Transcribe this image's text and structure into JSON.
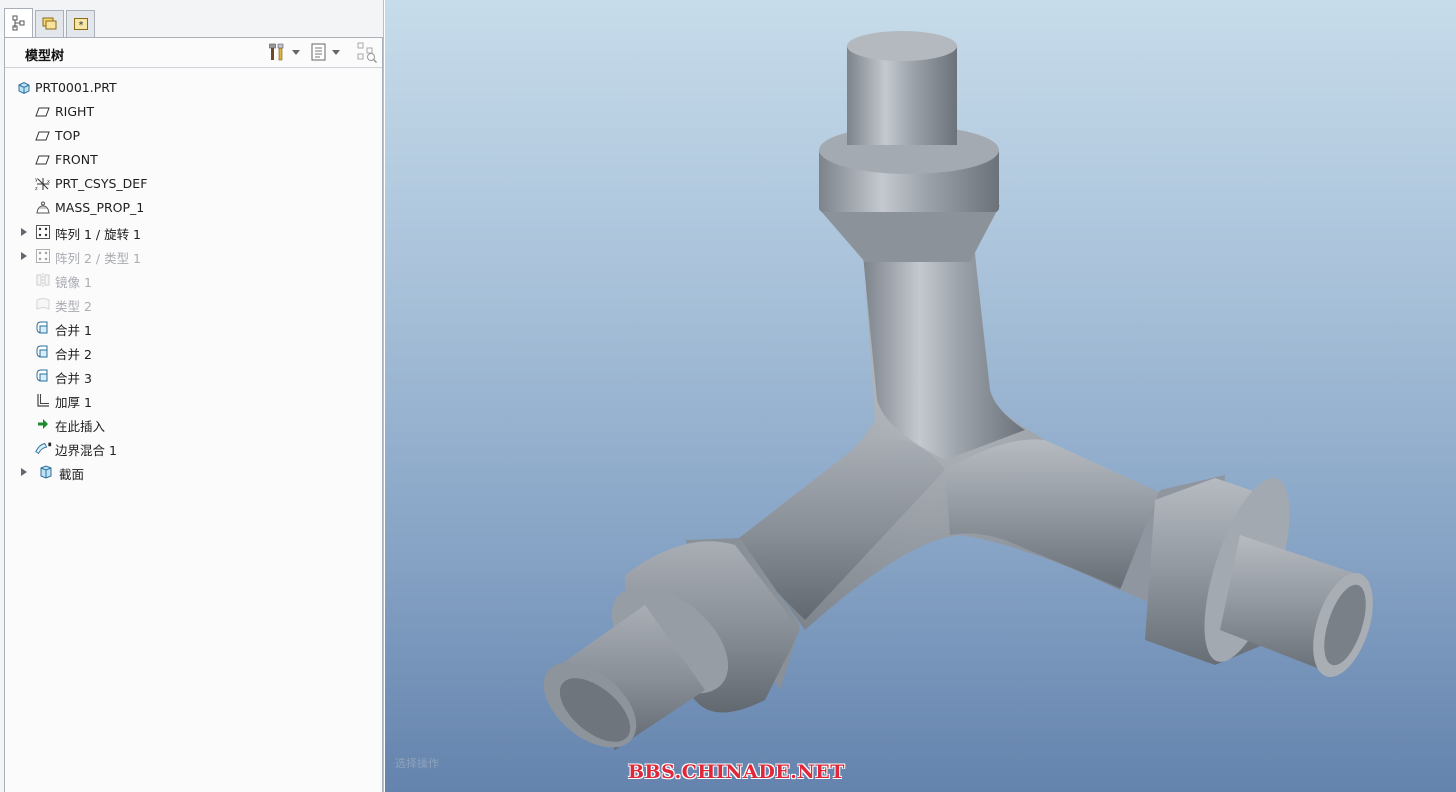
{
  "panel": {
    "tabs": [
      {
        "icon": "model-tree-icon"
      },
      {
        "icon": "folder-browser-icon"
      },
      {
        "icon": "favorites-icon"
      }
    ],
    "title": "模型树",
    "tools": [
      {
        "icon": "settings-tools-icon"
      },
      {
        "icon": "show-list-icon"
      },
      {
        "icon": "tree-filter-icon"
      }
    ]
  },
  "tree": {
    "items": [
      {
        "label": "PRT0001.PRT",
        "icon": "part-icon",
        "level": 0,
        "expandable": false,
        "suppressed": false
      },
      {
        "label": "RIGHT",
        "icon": "datum-plane-icon",
        "level": 1,
        "expandable": false,
        "suppressed": false
      },
      {
        "label": "TOP",
        "icon": "datum-plane-icon",
        "level": 1,
        "expandable": false,
        "suppressed": false
      },
      {
        "label": "FRONT",
        "icon": "datum-plane-icon",
        "level": 1,
        "expandable": false,
        "suppressed": false
      },
      {
        "label": "PRT_CSYS_DEF",
        "icon": "coordinate-system-icon",
        "level": 1,
        "expandable": false,
        "suppressed": false
      },
      {
        "label": "MASS_PROP_1",
        "icon": "mass-property-icon",
        "level": 1,
        "expandable": false,
        "suppressed": false
      },
      {
        "label": "阵列 1 / 旋转 1",
        "icon": "pattern-icon",
        "level": 1,
        "expandable": true,
        "suppressed": false
      },
      {
        "label": "阵列 2 / 类型 1",
        "icon": "pattern-icon",
        "level": 1,
        "expandable": true,
        "suppressed": true
      },
      {
        "label": "镜像 1",
        "icon": "mirror-icon",
        "level": 1,
        "expandable": false,
        "suppressed": true
      },
      {
        "label": "类型 2",
        "icon": "surface-type-icon",
        "level": 1,
        "expandable": false,
        "suppressed": true
      },
      {
        "label": "合并 1",
        "icon": "merge-icon",
        "level": 1,
        "expandable": false,
        "suppressed": false
      },
      {
        "label": "合并 2",
        "icon": "merge-icon",
        "level": 1,
        "expandable": false,
        "suppressed": false
      },
      {
        "label": "合并 3",
        "icon": "merge-icon",
        "level": 1,
        "expandable": false,
        "suppressed": false
      },
      {
        "label": "加厚 1",
        "icon": "thicken-icon",
        "level": 1,
        "expandable": false,
        "suppressed": false
      },
      {
        "label": "在此插入",
        "icon": "insert-here-arrow-icon",
        "level": 1,
        "expandable": false,
        "suppressed": false
      },
      {
        "label": "边界混合 1",
        "icon": "boundary-blend-icon",
        "level": 1,
        "expandable": false,
        "suppressed": false
      },
      {
        "label": "截面",
        "icon": "section-icon",
        "level": 0,
        "expandable": true,
        "suppressed": false
      }
    ]
  },
  "graphics": {
    "status_text": "选择操作",
    "watermark": "BBS.CHINADE.NET",
    "model_icon": "y-pipe-3d-model",
    "background_top": "#c7dcea",
    "background_bottom": "#6483ad",
    "model_color": "#9aa0a8"
  }
}
